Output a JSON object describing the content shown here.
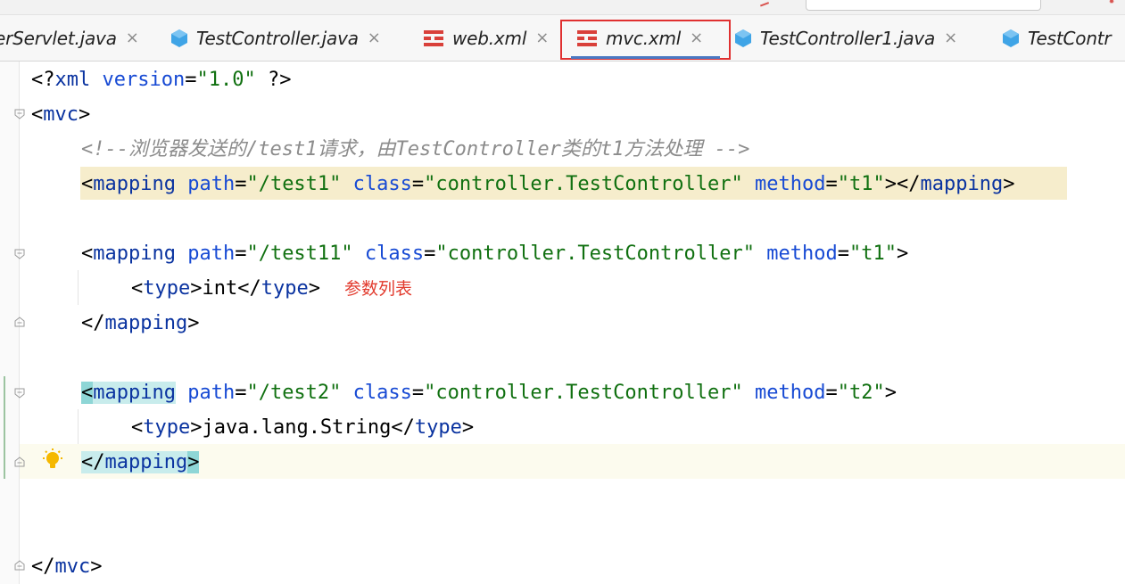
{
  "tabs": [
    {
      "label": "erServlet.java",
      "type": "java",
      "active": false
    },
    {
      "label": "TestController.java",
      "type": "java",
      "active": false
    },
    {
      "label": "web.xml",
      "type": "xml",
      "active": false
    },
    {
      "label": "mvc.xml",
      "type": "xml",
      "active": true
    },
    {
      "label": "TestController1.java",
      "type": "java",
      "active": false
    },
    {
      "label": "TestContr",
      "type": "java",
      "active": false
    }
  ],
  "tab_close_glyph": "×",
  "code": {
    "l1": {
      "open": "<?",
      "decl": "xml",
      "sp": " ",
      "attr": "version",
      "eq": "=",
      "val": "\"1.0\"",
      "close": " ?>"
    },
    "l2": {
      "open": "<",
      "tag": "mvc",
      "close": ">"
    },
    "l3": {
      "comment": "<!--浏览器发送的/test1请求，由TestController类的t1方法处理 -->"
    },
    "l4": {
      "lt": "<",
      "tag": "mapping",
      "a1": "path",
      "v1": "\"/test1\"",
      "a2": "class",
      "v2": "\"controller.TestController\"",
      "a3": "method",
      "v3": "\"t1\"",
      "mid": "></",
      "tag_end": "mapping",
      "gt": ">"
    },
    "l6": {
      "lt": "<",
      "tag": "mapping",
      "a1": "path",
      "v1": "\"/test11\"",
      "a2": "class",
      "v2": "\"controller.TestController\"",
      "a3": "method",
      "v3": "\"t1\"",
      "gt": ">"
    },
    "l7": {
      "lt": "<",
      "tag": "type",
      "text": "int",
      "close_open": "</",
      "tag_end": "type",
      "gt": ">"
    },
    "l8": {
      "lt": "</",
      "tag": "mapping",
      "gt": ">"
    },
    "l10": {
      "lt": "<",
      "tag": "mapping",
      "a1": "path",
      "v1": "\"/test2\"",
      "a2": "class",
      "v2": "\"controller.TestController\"",
      "a3": "method",
      "v3": "\"t2\"",
      "gt": ">"
    },
    "l11": {
      "lt": "<",
      "tag": "type",
      "text": "java.lang.String",
      "close_open": "</",
      "tag_end": "type",
      "gt": ">"
    },
    "l12": {
      "lt": "</",
      "tag": "mapping",
      "gt": ">"
    },
    "l15": {
      "lt": "</",
      "tag": "mvc",
      "gt": ">"
    }
  },
  "annotation": "参数列表",
  "colors": {
    "tag": "#0a33a0",
    "attribute": "#174ad4",
    "value": "#107010",
    "comment": "#8c8c8c",
    "annotation": "#e23b2e",
    "active_tab_box": "#e03030"
  },
  "icons": {
    "java": "java-class-icon",
    "xml": "xml-file-icon",
    "fold": "fold-icon",
    "bulb": "intention-bulb-icon"
  }
}
